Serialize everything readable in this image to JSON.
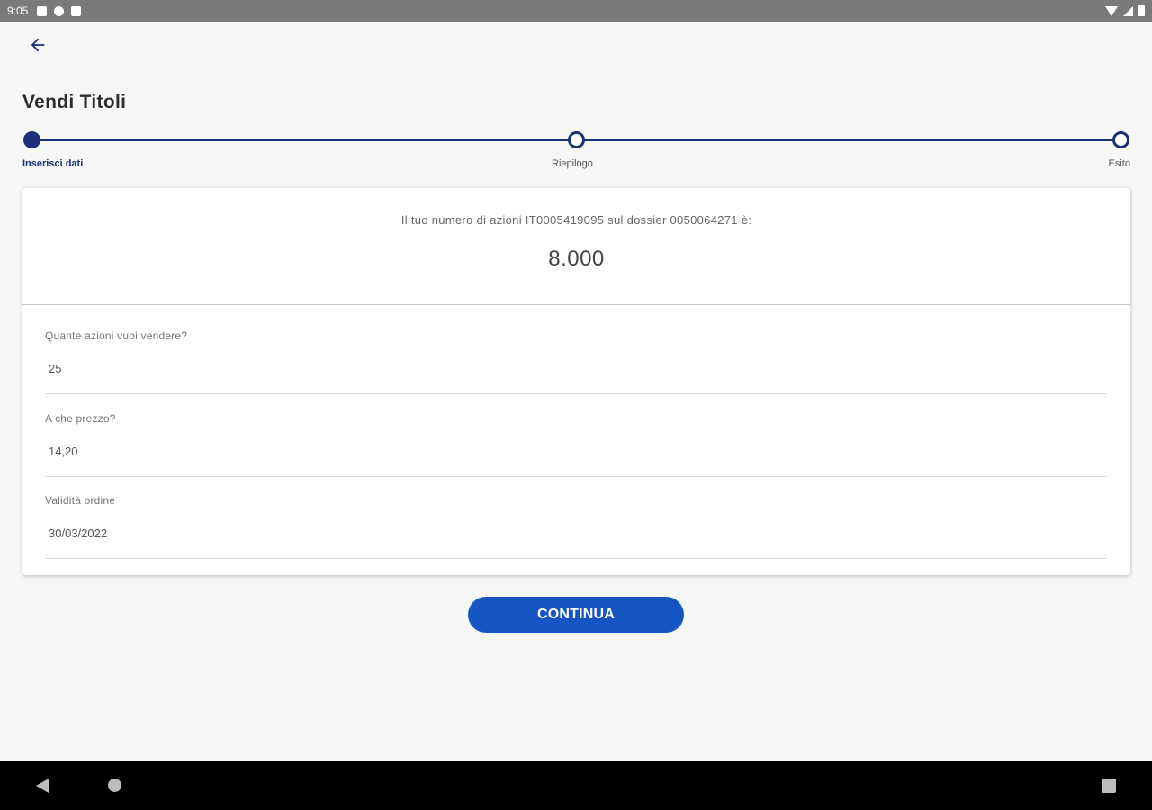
{
  "status_bar": {
    "time": "9:05",
    "icons": [
      "notification-icon",
      "app-icon",
      "sd-card-icon"
    ],
    "right_icons": [
      "wifi-icon",
      "signal-icon",
      "battery-icon"
    ]
  },
  "header": {
    "back_icon": "arrow-left-icon",
    "title": "Vendi Titoli"
  },
  "stepper": {
    "steps": [
      {
        "label": "Inserisci dati",
        "state": "active"
      },
      {
        "label": "Riepilogo",
        "state": "pending"
      },
      {
        "label": "Esito",
        "state": "pending"
      }
    ]
  },
  "summary": {
    "info_text": "Il tuo numero di azioni IT0005419095 sul dossier 0050064271 è:",
    "shares_count": "8.000"
  },
  "form": {
    "fields": [
      {
        "label": "Quante azioni vuoi vendere?",
        "value": "25"
      },
      {
        "label": "A che prezzo?",
        "value": "14,20"
      },
      {
        "label": "Validità ordine",
        "value": "30/03/2022"
      }
    ]
  },
  "actions": {
    "continue_label": "CONTINUA"
  },
  "colors": {
    "primary": "#1c2f7a",
    "button": "#1656c2",
    "background": "#f7f7f8"
  }
}
